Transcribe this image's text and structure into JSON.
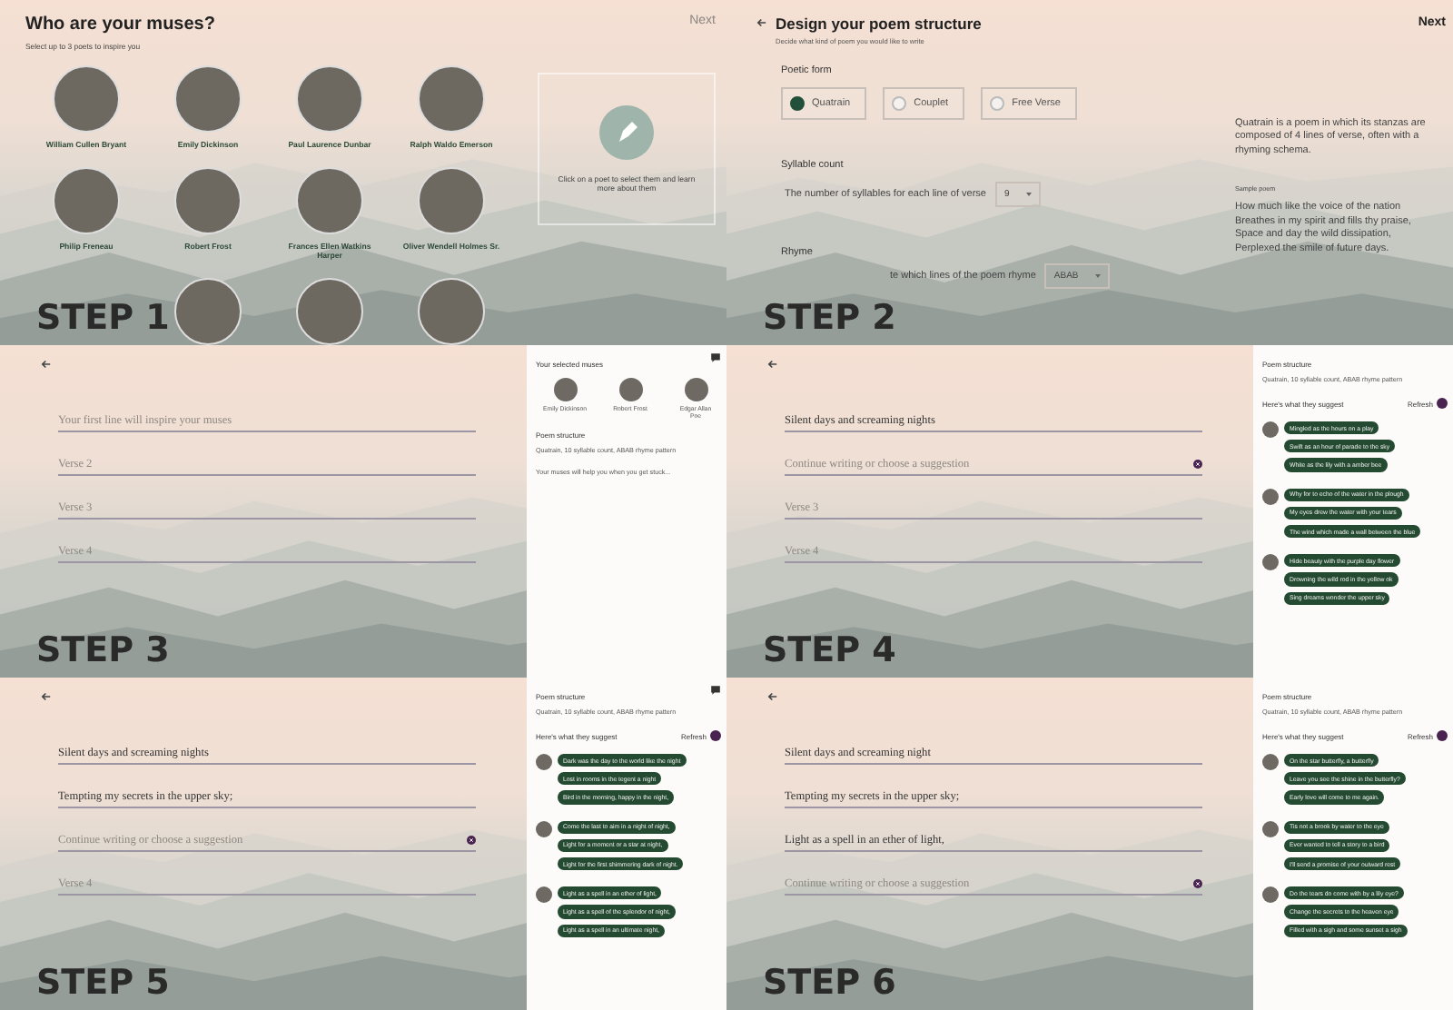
{
  "panels": [
    {
      "kind": "muses",
      "step": "STEP 1",
      "title": "Who are your muses?",
      "subtitle": "Select up to 3 poets to inspire you",
      "next": "Next",
      "next_disabled": true,
      "poets": [
        {
          "name": "William Cullen Bryant"
        },
        {
          "name": "Emily Dickinson"
        },
        {
          "name": "Paul Laurence Dunbar"
        },
        {
          "name": "Ralph Waldo Emerson"
        },
        {
          "name": "Philip Freneau"
        },
        {
          "name": "Robert Frost"
        },
        {
          "name": "Frances Ellen Watkins Harper"
        },
        {
          "name": "Oliver Wendell Holmes Sr."
        }
      ],
      "hint": "Click on a poet to select them and learn more about them"
    },
    {
      "kind": "structure",
      "step": "STEP 2",
      "title": "Design your poem structure",
      "subtitle": "Decide what kind of poem you would like to write",
      "next": "Next",
      "next_disabled": false,
      "form_label": "Poetic form",
      "forms": [
        {
          "label": "Quatrain",
          "selected": true
        },
        {
          "label": "Couplet",
          "selected": false
        },
        {
          "label": "Free Verse",
          "selected": false
        }
      ],
      "syllable_label": "Syllable count",
      "syllable_text": "The number of syllables for each line of verse",
      "syllables": "9",
      "rhyme_label": "Rhyme",
      "rhyme_text": "te which lines of the poem rhyme",
      "rhyme": "ABAB",
      "description": "Quatrain is a poem in which its stanzas are composed of 4 lines of verse, often with a rhyming schema.",
      "sample_label": "Sample poem",
      "sample": [
        "How much like the voice of the nation",
        "Breathes in my spirit and fills thy praise,",
        "Space and day the wild dissipation,",
        "Perplexed the smile of future days."
      ]
    },
    {
      "kind": "editor",
      "step": "STEP 3",
      "comment_button": true,
      "verses": [
        {
          "placeholder": "Your first line will inspire your muses",
          "active": false
        },
        {
          "placeholder": "Verse 2",
          "active": false
        },
        {
          "placeholder": "Verse 3",
          "active": false
        },
        {
          "placeholder": "Verse 4",
          "active": false
        }
      ],
      "sidebar": {
        "kind": "summary",
        "muses_title": "Your selected muses",
        "muses": [
          "Emily Dickinson",
          "Robert Frost",
          "Edgar Allan Poe"
        ],
        "structure_title": "Poem structure",
        "structure": "Quatrain, 10 syllable count, ABAB rhyme pattern",
        "note": "Your muses will help you when you get stuck..."
      }
    },
    {
      "kind": "editor",
      "step": "STEP 4",
      "comment_button": false,
      "verses": [
        {
          "value": "Silent days and screaming nights",
          "active": false
        },
        {
          "placeholder": "Continue writing or choose a suggestion",
          "active": true
        },
        {
          "placeholder": "Verse 3",
          "active": false
        },
        {
          "placeholder": "Verse 4",
          "active": false
        }
      ],
      "sidebar": {
        "kind": "suggestions",
        "structure_title": "Poem structure",
        "structure": "Quatrain, 10 syllable count, ABAB rhyme pattern",
        "suggest_title": "Here's what they suggest",
        "refresh": "Refresh",
        "groups": [
          {
            "chips": [
              "Mingled as the hours on a play",
              "Swift as an hour of parade to the sky",
              "White as the lily with a amber bee"
            ]
          },
          {
            "chips": [
              "Why for to echo of the water in the plough",
              "My eyes drew the water with your tears",
              "The wind which made a wall between the blue"
            ]
          },
          {
            "chips": [
              "Hide beauty with the purple day flower",
              "Drowning the wild rod in the yellow ok",
              "Sing dreams wonder the upper sky"
            ]
          }
        ]
      }
    },
    {
      "kind": "editor",
      "step": "STEP 5",
      "comment_button": true,
      "verses": [
        {
          "value": "Silent days and screaming nights",
          "active": false
        },
        {
          "value": "Tempting my secrets in the upper sky;",
          "active": false
        },
        {
          "placeholder": "Continue writing or choose a suggestion",
          "active": true
        },
        {
          "placeholder": "Verse 4",
          "active": false
        }
      ],
      "sidebar": {
        "kind": "suggestions",
        "structure_title": "Poem structure",
        "structure": "Quatrain, 10 syllable count, ABAB rhyme pattern",
        "suggest_title": "Here's what they suggest",
        "refresh": "Refresh",
        "groups": [
          {
            "chips": [
              "Dark was the day to the world like the night",
              "Lost in rooms in the tegent a night",
              "Bird in the morning, happy in the night,"
            ]
          },
          {
            "chips": [
              "Come the last to aim in a night of night,",
              "Light for a moment or a star at night,",
              "Light for the first shimmering dark of night."
            ]
          },
          {
            "chips": [
              "Light as a spell in an ether of light,",
              "Light as a spell of the splendor of night,",
              "Light as a spell in an ultimate night,"
            ]
          }
        ]
      }
    },
    {
      "kind": "editor",
      "step": "STEP 6",
      "comment_button": false,
      "verses": [
        {
          "value": "Silent days and screaming night",
          "active": false
        },
        {
          "value": "Tempting my secrets in the upper sky;",
          "active": false
        },
        {
          "value": "Light as a spell in an ether of light,",
          "active": false
        },
        {
          "placeholder": "Continue writing or choose a suggestion",
          "active": true
        }
      ],
      "sidebar": {
        "kind": "suggestions",
        "structure_title": "Poem structure",
        "structure": "Quatrain, 10 syllable count, ABAB rhyme pattern",
        "suggest_title": "Here's what they suggest",
        "refresh": "Refresh",
        "groups": [
          {
            "chips": [
              "On the star butterfly, a butterfly",
              "Leave you see the shine in the butterfly?",
              "Early love will come to me again."
            ]
          },
          {
            "chips": [
              "Tis not a brook by water to the eye",
              "Ever wanted to tell a story to a bird",
              "I'll send a promise of your outward rest"
            ]
          },
          {
            "chips": [
              "Do the tears do come with by a lily eye?",
              "Change the secrets to the heaven eye",
              "Filled with a sigh and some sunset a sigh"
            ]
          }
        ]
      }
    }
  ]
}
